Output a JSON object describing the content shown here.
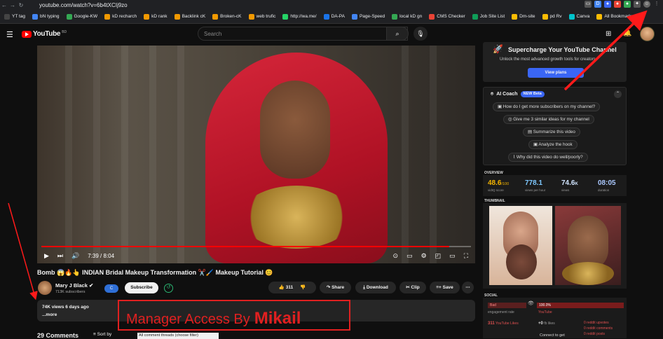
{
  "browser": {
    "url": "youtube.com/watch?v=6b4tXCIj9zo",
    "bookmarks": [
      {
        "label": "YT tag",
        "color": "#444"
      },
      {
        "label": "bN typing",
        "color": "#4285f4"
      },
      {
        "label": "Google-KW",
        "color": "#34a853"
      },
      {
        "label": "kD recharch",
        "color": "#f29900"
      },
      {
        "label": "kD rank",
        "color": "#f29900"
      },
      {
        "label": "Backlink cK",
        "color": "#f29900"
      },
      {
        "label": "Broken-cK",
        "color": "#f29900"
      },
      {
        "label": "web trufic",
        "color": "#f29900"
      },
      {
        "label": "http://wa.me/",
        "color": "#25d366"
      },
      {
        "label": "DA-PA",
        "color": "#1a73e8"
      },
      {
        "label": "Page-Speed",
        "color": "#4285f4"
      },
      {
        "label": "local kD gn",
        "color": "#34a853"
      },
      {
        "label": "CMS Checker",
        "color": "#ea4335"
      },
      {
        "label": "Job Site List",
        "color": "#0f9d58"
      },
      {
        "label": "Dm-site",
        "color": "#fbbc04"
      },
      {
        "label": "pd Rv",
        "color": "#fbbc04"
      },
      {
        "label": "Canva",
        "color": "#00c4cc"
      },
      {
        "label": "All Bookmarks",
        "color": "#fbbc04"
      }
    ]
  },
  "header": {
    "logo_text": "YouTube",
    "logo_country": "BD",
    "search_placeholder": "Search"
  },
  "player": {
    "time": "7:39 / 8:04",
    "progress": 0.95
  },
  "video": {
    "title": "Bomb 😱🔥👆 INDIAN Bridal Makeup Transformation ✂️🖌️ Makeup Tutorial 😊",
    "channel_name": "Mary J Black ✔",
    "subscribers": "713K subscribers",
    "subscribe_label": "Subscribe",
    "likes": "311",
    "share_label": "Share",
    "download_label": "Download",
    "clip_label": "Clip",
    "save_label": "Save",
    "views_date": "74K views  6 days ago",
    "more_label": "...more"
  },
  "overlay": {
    "manager_prefix": "Manager Access By",
    "manager_name": "Mikail"
  },
  "comments": {
    "count_label": "29 Comments",
    "sort_label": "Sort by",
    "filter_value": "All comment threads (choose filter)"
  },
  "sidebar": {
    "promo_title": "Supercharge Your YouTube Channel",
    "promo_sub": "Unlock the most advanced growth tools for creators",
    "promo_button": "View plans",
    "coach_title": "AI Coach",
    "coach_badge": "NEW Beta",
    "coach_questions": [
      "How do I get more subscribers on my channel?",
      "Give me 3 similar ideas for my channel",
      "Summarize this video",
      "Analyze the hook",
      "Why did this video do well/poorly?"
    ],
    "overview_label": "OVERVIEW",
    "overview": [
      {
        "value": "48.6",
        "suffix": "/100",
        "label": "vidIQ score",
        "color": "#f4b400"
      },
      {
        "value": "778.1",
        "label": "views per hour",
        "color": "#7ec8ff"
      },
      {
        "value": "74.6",
        "suffix": "K",
        "label": "views",
        "color": "#d0e4ff"
      },
      {
        "value": "08:05",
        "label": "duration",
        "color": "#aac8ff"
      }
    ],
    "thumbnail_label": "THUMBNAIL",
    "social_label": "SOCIAL",
    "social": {
      "engagement_badge": "Bad",
      "engagement_label": "engagement rate",
      "youtube_pct": "100.0%",
      "youtube_label": "YouTube",
      "likes_value": "311",
      "likes_label": "YouTube Likes",
      "fb_value": "+0",
      "fb_label": "fb likes",
      "reddit_upvotes": "0  reddit upvotes",
      "reddit_comments": "0  reddit comments",
      "reddit_posts": "0  reddit posts",
      "connect_label": "Connect to get"
    }
  },
  "colors": {
    "accent_red": "#ff0000",
    "overlay_red": "#e02020",
    "vidiq_blue": "#3a66f5"
  }
}
